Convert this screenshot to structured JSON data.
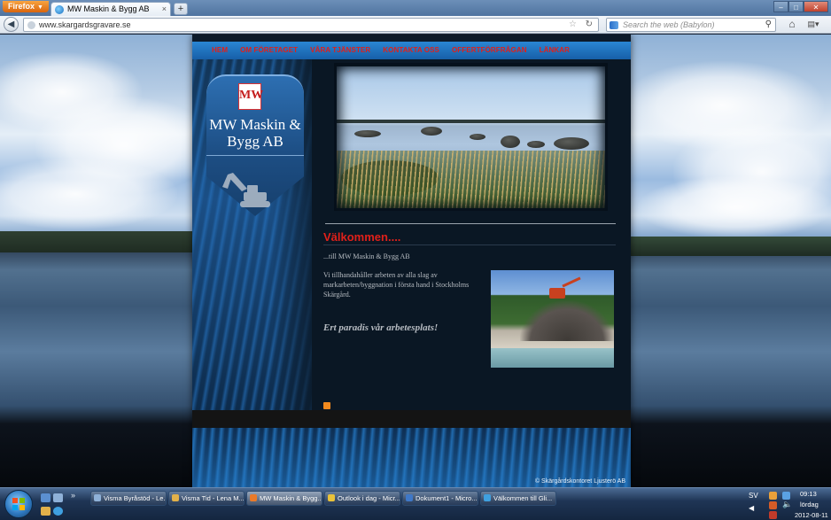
{
  "browser": {
    "menu_button": "Firefox",
    "tab_title": "MW Maskin & Bygg AB",
    "tab_close": "×",
    "new_tab": "+",
    "url": "www.skargardsgravare.se",
    "search_placeholder": "Search the web (Babylon)",
    "window_controls": [
      "–",
      "□",
      "✕"
    ]
  },
  "site": {
    "nav": [
      "HEM",
      "OM FÖRETAGET",
      "VÅRA TJÄNSTER",
      "KONTAKTA OSS",
      "OFFERTFÖRFRÅGAN",
      "LÄNKAR"
    ],
    "logo_mark": "MW",
    "company_name": "MW Maskin & Bygg AB",
    "welcome_title": "Välkommen....",
    "subtitle": "...till MW Maskin & Bygg AB",
    "intro": "Vi tillhandahåller arbeten av alla slag av markarbeten/byggnation i första hand i Stockholms Skärgård.",
    "slogan": "Ert paradis vår arbetesplats!",
    "copyright": "© Skärgårdskontoret Ljusterö AB"
  },
  "taskbar": {
    "tasks": [
      {
        "label": "Visma Byråstöd - Le...",
        "color": "#8fb1d8",
        "active": false
      },
      {
        "label": "Visma Tid - Lena M...",
        "color": "#e2b14a",
        "active": false
      },
      {
        "label": "MW Maskin & Bygg...",
        "color": "#e97a2a",
        "active": true
      },
      {
        "label": "Outlook i dag - Micr...",
        "color": "#e9c23a",
        "active": false
      },
      {
        "label": "Dokument1 - Micro...",
        "color": "#3f78c8",
        "active": false
      },
      {
        "label": "Välkommen till Gli...",
        "color": "#3fa0e0",
        "active": false
      }
    ],
    "language": "SV",
    "time": "09:13",
    "day": "lördag",
    "date": "2012-08-11"
  }
}
